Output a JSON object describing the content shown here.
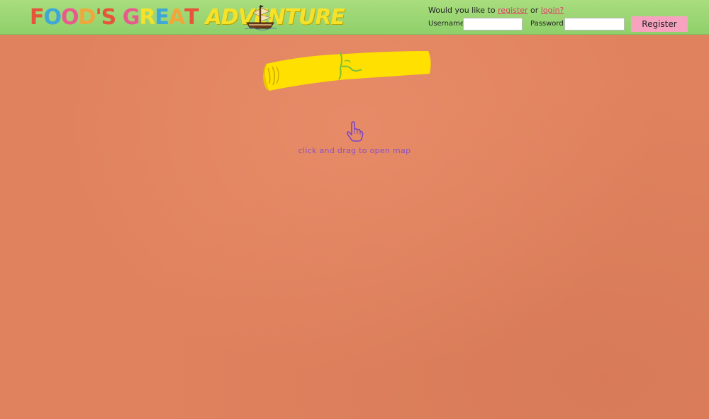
{
  "header": {
    "logo_text": "FOOD'S GREAT ADVENTURE",
    "logo_letters": [
      {
        "ch": "F",
        "color": "#e6543a"
      },
      {
        "ch": "O",
        "color": "#3fa6d8"
      },
      {
        "ch": "O",
        "color": "#e85a8c"
      },
      {
        "ch": "D",
        "color": "#f0a63a"
      },
      {
        "ch": "'",
        "color": "#e6543a"
      },
      {
        "ch": "S",
        "color": "#e6543a"
      },
      {
        "ch": " ",
        "color": "#000000"
      },
      {
        "ch": "G",
        "color": "#e85a8c"
      },
      {
        "ch": "R",
        "color": "#f7e22a"
      },
      {
        "ch": "E",
        "color": "#3fa6d8"
      },
      {
        "ch": "A",
        "color": "#f0a63a"
      },
      {
        "ch": "T",
        "color": "#e6543a"
      }
    ],
    "logo_adventure": "ADVENTURE",
    "ship_icon": "pirate-ship-icon"
  },
  "login": {
    "prompt_prefix": "Would you like to",
    "register_link": "register",
    "prompt_middle": "or",
    "login_link": "login?",
    "username_label": "Username:",
    "username_value": "",
    "password_label": "Password:",
    "password_value": "",
    "register_button": "Register"
  },
  "main": {
    "map_icon": "rolled-map-icon",
    "hand_icon": "pointing-hand-icon",
    "hint_text": "click and drag to open map"
  },
  "colors": {
    "header_green": "#9ad673",
    "background_orange": "#e0825e",
    "map_yellow": "#ffe000",
    "hint_purple": "#8a4fc6",
    "link_pink": "#e23b6a",
    "button_pink": "#f7a2bf"
  }
}
